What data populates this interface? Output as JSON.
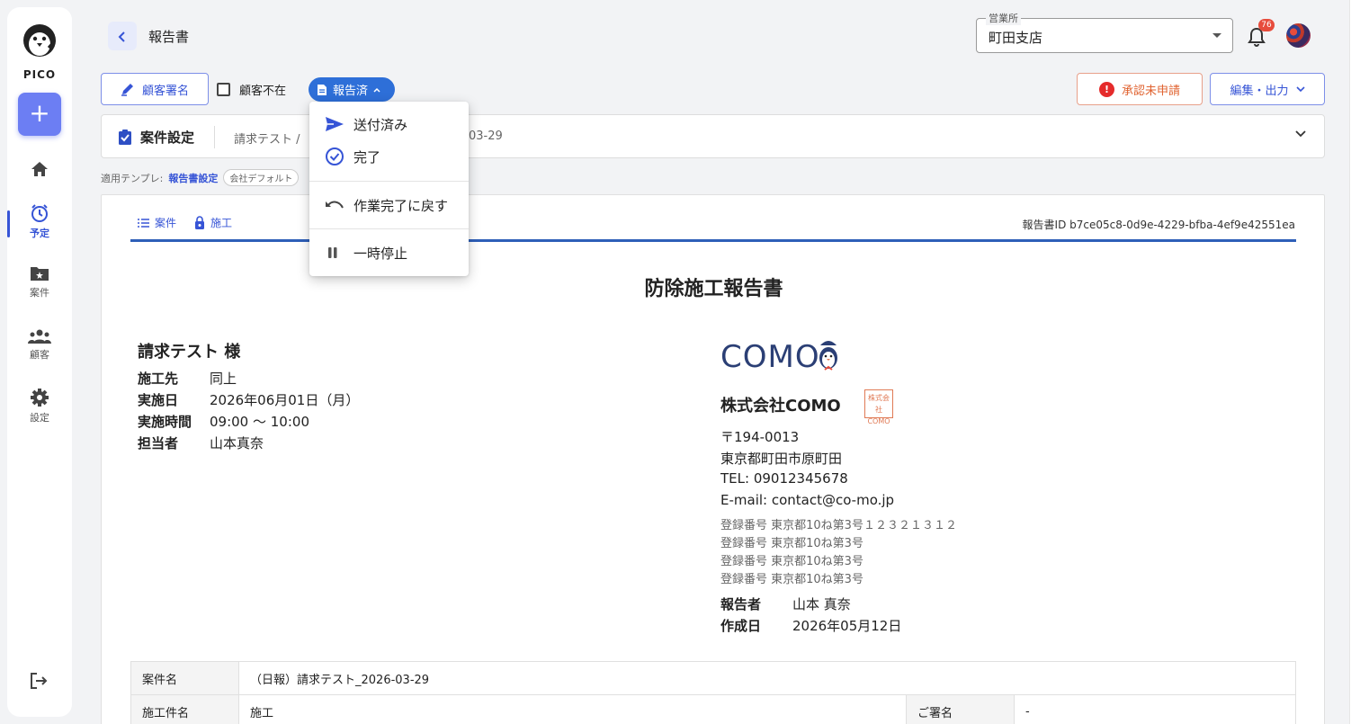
{
  "app": {
    "name": "PICO"
  },
  "sidebar": {
    "items": [
      {
        "label": "",
        "icon": "home-icon"
      },
      {
        "label": "予定",
        "icon": "alarm-icon",
        "active": true
      },
      {
        "label": "案件",
        "icon": "folder-star-icon"
      },
      {
        "label": "顧客",
        "icon": "people-icon"
      },
      {
        "label": "設定",
        "icon": "gear-icon"
      }
    ]
  },
  "header": {
    "title": "報告書",
    "branch_label": "営業所",
    "branch_value": "町田支店",
    "notification_count": "76"
  },
  "toolbar": {
    "sign_label": "顧客署名",
    "absent_label": "顧客不在",
    "status_label": "報告済",
    "approval_label": "承認未申請",
    "edit_label": "編集・出力"
  },
  "status_menu": {
    "items": [
      {
        "label": "送付済み",
        "icon": "send-icon"
      },
      {
        "label": "完了",
        "icon": "check-circle-icon"
      },
      {
        "label": "作業完了に戻す",
        "icon": "undo-icon"
      },
      {
        "label": "一時停止",
        "icon": "pause-icon"
      }
    ]
  },
  "case_panel": {
    "title": "案件設定",
    "crumb": "請求テスト /",
    "crumb_date": "03-29"
  },
  "template": {
    "prefix": "適用テンプレ:",
    "link": "報告書設定",
    "chip": "会社デフォルト"
  },
  "report": {
    "tabs": [
      "案件",
      "施工"
    ],
    "id_text": "報告書ID b7ce05c8-0d9e-4229-bfba-4ef9e42551ea",
    "heading": "防除施工報告書",
    "customer": "請求テスト 様",
    "info": [
      {
        "key": "施工先",
        "value": "同上"
      },
      {
        "key": "実施日",
        "value": "2026年06月01日（月）"
      },
      {
        "key": "実施時間",
        "value": "09:00 〜 10:00"
      },
      {
        "key": "担当者",
        "value": "山本真奈"
      }
    ],
    "company": {
      "logo_text": "COMO",
      "name": "株式会社COMO",
      "seal_lines": [
        "株式会",
        "社",
        "COMO"
      ],
      "address": [
        "〒194-0013",
        "東京都町田市原町田",
        "TEL: 09012345678",
        "E-mail: contact@co-mo.jp"
      ],
      "registrations": [
        "登録番号 東京都10ね第3号１２３２１３１２",
        "登録番号 東京都10ね第3号",
        "登録番号 東京都10ね第3号",
        "登録番号 東京都10ね第3号"
      ],
      "reporter_key": "報告者",
      "reporter_value": "山本 真奈",
      "created_key": "作成日",
      "created_value": "2026年05月12日"
    },
    "table": {
      "case_name_label": "案件名",
      "case_name_value": "（日報）請求テスト_2026-03-29",
      "work_name_label": "施工件名",
      "work_name_value": "施工",
      "signature_label": "ご署名",
      "signature_value": "-"
    }
  },
  "colors": {
    "primary": "#3654d6",
    "status_chip": "#2e6fd8",
    "warning": "#e0622f",
    "report_rule": "#2e5fb8"
  }
}
